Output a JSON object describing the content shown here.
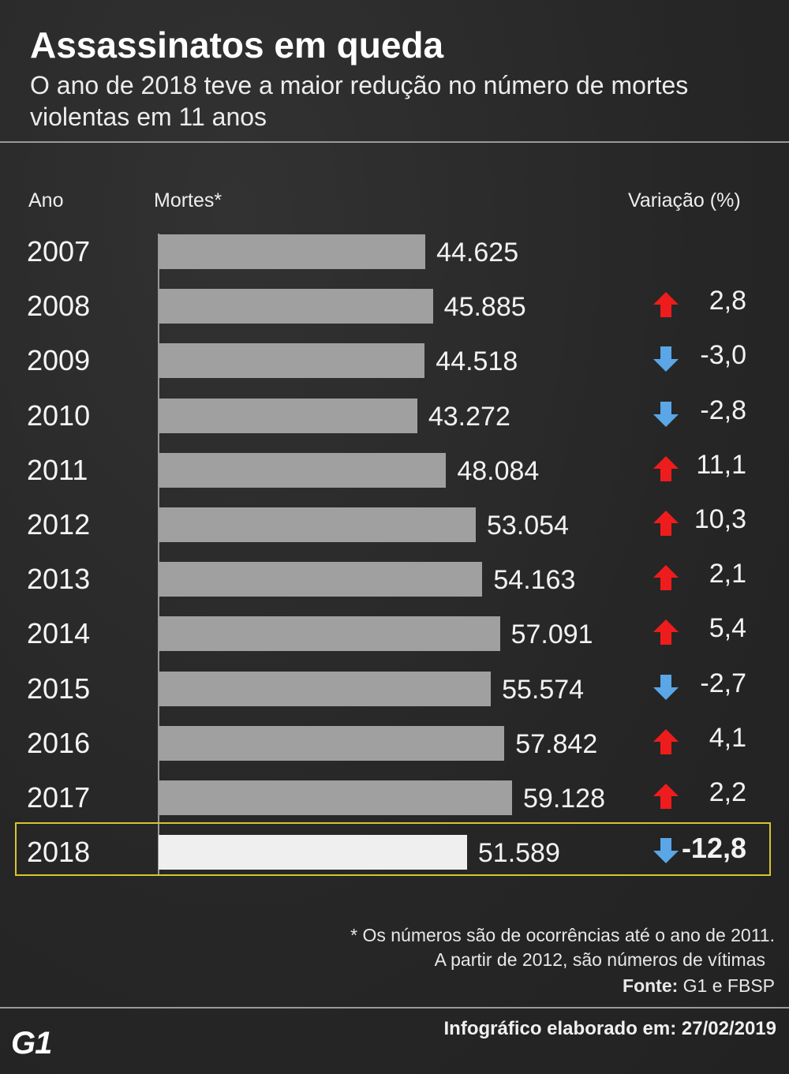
{
  "header": {
    "title": "Assassinatos em queda",
    "subtitle": "O ano de 2018 teve a maior redução no número de mortes violentas em 11 anos"
  },
  "columns": {
    "year": "Ano",
    "deaths": "Mortes*",
    "variation": "Variação (%)"
  },
  "chart_data": {
    "type": "bar",
    "orientation": "horizontal",
    "categories": [
      "2007",
      "2008",
      "2009",
      "2010",
      "2011",
      "2012",
      "2013",
      "2014",
      "2015",
      "2016",
      "2017",
      "2018"
    ],
    "values": [
      44625,
      45885,
      44518,
      43272,
      48084,
      53054,
      54163,
      57091,
      55574,
      57842,
      59128,
      51589
    ],
    "value_labels": [
      "44.625",
      "45.885",
      "44.518",
      "43.272",
      "48.084",
      "53.054",
      "54.163",
      "57.091",
      "55.574",
      "57.842",
      "59.128",
      "51.589"
    ],
    "variation": [
      null,
      2.8,
      -3.0,
      -2.8,
      11.1,
      10.3,
      2.1,
      5.4,
      -2.7,
      4.1,
      2.2,
      -12.8
    ],
    "variation_labels": [
      "",
      "2,8",
      "-3,0",
      "-2,8",
      "11,1",
      "10,3",
      "2,1",
      "5,4",
      "-2,7",
      "4,1",
      "2,2",
      "-12,8"
    ],
    "highlight": "2018",
    "colors": {
      "bar": "#a0a0a0",
      "bar_highlight": "#efefef",
      "up": "#ee1c1c",
      "down": "#5aa6e6",
      "highlight_border": "#d7c52c"
    },
    "grid": false
  },
  "footer": {
    "note_line1": "* Os números são de ocorrências até o ano de 2011.",
    "note_line2": "A partir de 2012, são números de vítimas",
    "source_label": "Fonte:",
    "source_value": "G1 e FBSP",
    "logo": "G1",
    "credit": "Infográfico elaborado em: 27/02/2019"
  }
}
